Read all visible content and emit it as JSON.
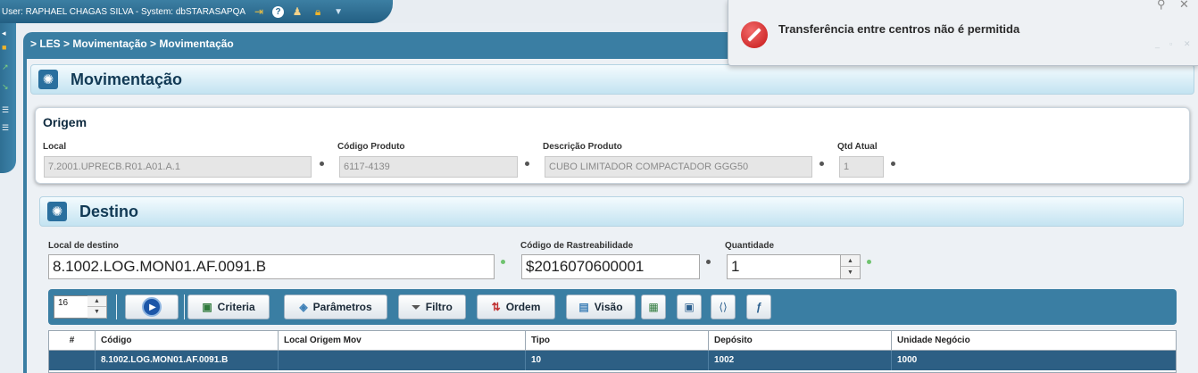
{
  "topbar": {
    "user_text": "User: RAPHAEL CHAGAS SILVA - System: dbSTARASAPQA",
    "icons": [
      "exit-icon",
      "help-icon",
      "user-icon",
      "lock-icon",
      "dropdown-icon"
    ]
  },
  "breadcrumb": "> LES > Movimentação > Movimentação",
  "page": {
    "title": "Movimentação"
  },
  "origem": {
    "title": "Origem",
    "local_label": "Local",
    "local_value": "7.2001.UPRECB.R01.A01.A.1",
    "codigo_label": "Código Produto",
    "codigo_value": "6117-4139",
    "descricao_label": "Descrição Produto",
    "descricao_value": "CUBO LIMITADOR COMPACTADOR GGG50",
    "qtd_label": "Qtd Atual",
    "qtd_value": "1"
  },
  "destino": {
    "title": "Destino",
    "local_label": "Local de destino",
    "local_value": "8.1002.LOG.MON01.AF.0091.B",
    "rastreabilidade_label": "Código de Rastreabilidade",
    "rastreabilidade_value": "$2016070600001",
    "quantidade_label": "Quantidade",
    "quantidade_value": "1"
  },
  "toolbar": {
    "page_size": "16",
    "criteria_label": "Criteria",
    "parametros_label": "Parâmetros",
    "filtro_label": "Filtro",
    "ordem_label": "Ordem",
    "visao_label": "Visão"
  },
  "table": {
    "columns": [
      "#",
      "Código",
      "Local Origem Mov",
      "Tipo",
      "Depósito",
      "Unidade Negócio"
    ],
    "rows": [
      [
        "",
        "8.1002.LOG.MON01.AF.0091.B",
        "",
        "10",
        "1002",
        "1000"
      ]
    ]
  },
  "notification": {
    "message": "Transferência entre centros não é permitida"
  },
  "colors": {
    "accent": "#3a7ea3",
    "selected_row": "#2d5f84",
    "error": "#c41515"
  }
}
